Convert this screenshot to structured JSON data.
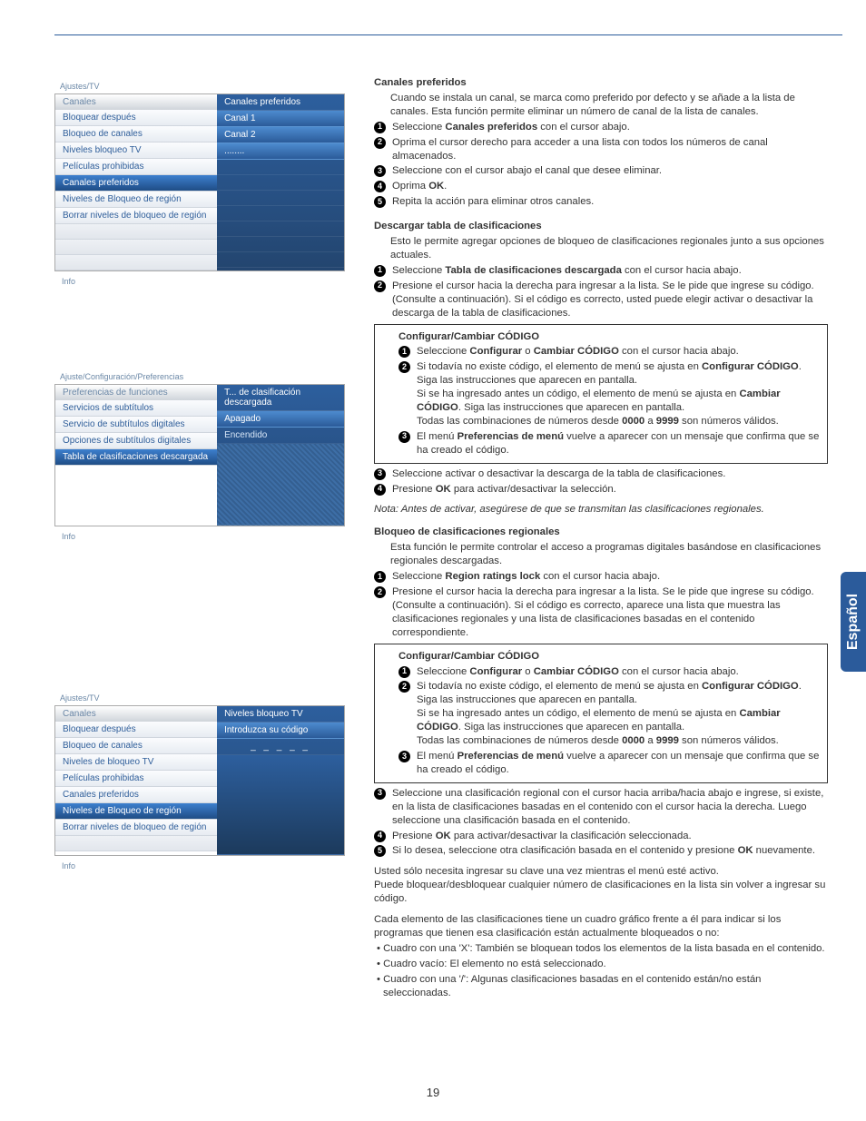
{
  "page_number": "19",
  "side_tab": "Español",
  "shot1": {
    "crumb": "Ajustes/TV",
    "left_header": "Canales",
    "right_header": "Canales preferidos",
    "menu": [
      "Bloquear después",
      "Bloqueo de canales",
      "Niveles bloqueo TV",
      "Películas prohibidas",
      "Canales preferidos",
      "Niveles de Bloqueo de región",
      "Borrar niveles de bloqueo de región"
    ],
    "selected_index": 4,
    "values": [
      "Canal 1",
      "Canal 2",
      "........"
    ],
    "info": "Info"
  },
  "shot2": {
    "crumb": "Ajuste/Configuración/Preferencias",
    "left_header": "Preferencias de funciones",
    "right_header": "T... de clasificación descargada",
    "menu": [
      "Servicios de subtítulos",
      "Servicio de subtítulos digitales",
      "Opciones de subtítulos digitales",
      "Tabla de clasificaciones descargada"
    ],
    "selected_index": 3,
    "values": [
      "Apagado",
      "Encendido"
    ],
    "info": "Info"
  },
  "shot3": {
    "crumb": "Ajustes/TV",
    "left_header": "Canales",
    "right_header": "Niveles bloqueo TV",
    "menu": [
      "Bloquear después",
      "Bloqueo de canales",
      "Niveles de bloqueo TV",
      "Películas prohibidas",
      "Canales preferidos",
      "Niveles de Bloqueo de región",
      "Borrar niveles de bloqueo de región"
    ],
    "selected_index": 5,
    "right_sub": "Introduzca su código",
    "code_mask": "_ _ _ _ _",
    "info": "Info"
  },
  "s1": {
    "title": "Canales preferidos",
    "intro": "Cuando se instala un canal, se marca como preferido por defecto y se añade a la lista de canales. Esta función permite eliminar un número de canal de la lista de canales.",
    "steps": [
      {
        "pre": "Seleccione ",
        "b": "Canales preferidos",
        "post": " con el cursor abajo."
      },
      {
        "pre": "Oprima el cursor derecho para acceder a una lista con todos los números de canal almacenados.",
        "b": "",
        "post": ""
      },
      {
        "pre": "Seleccione con el cursor abajo el canal que desee eliminar.",
        "b": "",
        "post": ""
      },
      {
        "pre": "Oprima ",
        "b": "OK",
        "post": "."
      },
      {
        "pre": "Repita la acción para eliminar otros canales.",
        "b": "",
        "post": ""
      }
    ]
  },
  "s2": {
    "title": "Descargar tabla de clasificaciones",
    "intro": "Esto le permite agregar opciones de bloqueo de clasificaciones regionales junto a sus opciones actuales.",
    "step1_pre": "Seleccione ",
    "step1_b": "Tabla de clasificaciones descargada",
    "step1_post": " con el cursor hacia abajo.",
    "step2": "Presione el cursor hacia la derecha para ingresar a la lista. Se le pide que ingrese su código. (Consulte a continuación). Si el código es correcto, usted puede elegir activar o desactivar la descarga de la tabla de clasificaciones.",
    "step3": "Seleccione activar o desactivar la descarga de la tabla de clasificaciones.",
    "step4_pre": "Presione ",
    "step4_b": "OK",
    "step4_post": " para activar/desactivar la selección."
  },
  "codebox": {
    "title": "Configurar/Cambiar CÓDIGO",
    "st1_pre": "Seleccione ",
    "st1_b1": "Configurar",
    "st1_mid": " o ",
    "st1_b2": "Cambiar CÓDIGO",
    "st1_post": " con el cursor hacia abajo.",
    "st2a_pre": "Si todavía no existe código, el elemento de menú se ajusta en ",
    "st2a_b": "Configurar CÓDIGO",
    "st2a_post": ". Siga las instrucciones que aparecen en pantalla.",
    "st2b_pre": "Si se ha ingresado antes un código, el elemento de menú se ajusta en ",
    "st2b_b": "Cambiar CÓDIGO",
    "st2b_post": ". Siga las instrucciones que aparecen en pantalla.",
    "st2c_pre": "Todas las combinaciones de números desde ",
    "st2c_b1": "0000",
    "st2c_mid": " a ",
    "st2c_b2": "9999",
    "st2c_post": " son números válidos.",
    "st3_pre": "El menú ",
    "st3_b": "Preferencias de menú",
    "st3_post": " vuelve a aparecer con un mensaje que confirma que se ha creado el código."
  },
  "note": "Nota: Antes de activar, asegúrese de que se transmitan las clasificaciones regionales.",
  "s3": {
    "title": "Bloqueo de clasificaciones regionales",
    "intro": "Esta función le permite controlar el acceso a programas digitales basándose en clasificaciones regionales descargadas.",
    "step1_pre": "Seleccione ",
    "step1_b": "Region ratings lock",
    "step1_post": " con el cursor hacia abajo.",
    "step2": "Presione el cursor hacia la derecha para ingresar a la lista. Se le pide que ingrese su código. (Consulte a continuación). Si el código es correcto, aparece una lista que muestra las clasificaciones regionales y una lista de clasificaciones basadas en el contenido correspondiente.",
    "step3": "Seleccione una clasificación regional con el cursor hacia arriba/hacia abajo e ingrese, si existe, en la lista de clasificaciones basadas en el contenido con el cursor hacia la derecha. Luego seleccione una clasificación basada en el contenido.",
    "step4_pre": "Presione ",
    "step4_b": "OK",
    "step4_post": " para activar/desactivar la clasificación seleccionada.",
    "step5_pre": "Si lo desea, seleccione otra clasificación basada en el contenido y presione ",
    "step5_b": "OK",
    "step5_post": " nuevamente."
  },
  "tail": {
    "p1": "Usted sólo necesita ingresar su clave una vez mientras el menú esté activo.",
    "p2": "Puede bloquear/desbloquear cualquier número de clasificaciones en la lista sin volver a ingresar su código.",
    "p3": "Cada elemento de las clasificaciones tiene un cuadro gráfico frente a él para indicar si los programas que tienen esa clasificación están actualmente bloqueados o no:",
    "b1": "• Cuadro con una 'X': También se bloquean todos los elementos de la lista basada en el contenido.",
    "b2": "• Cuadro vacío: El elemento no está seleccionado.",
    "b3": "• Cuadro con una '/': Algunas clasificaciones basadas en el contenido están/no están seleccionadas."
  }
}
